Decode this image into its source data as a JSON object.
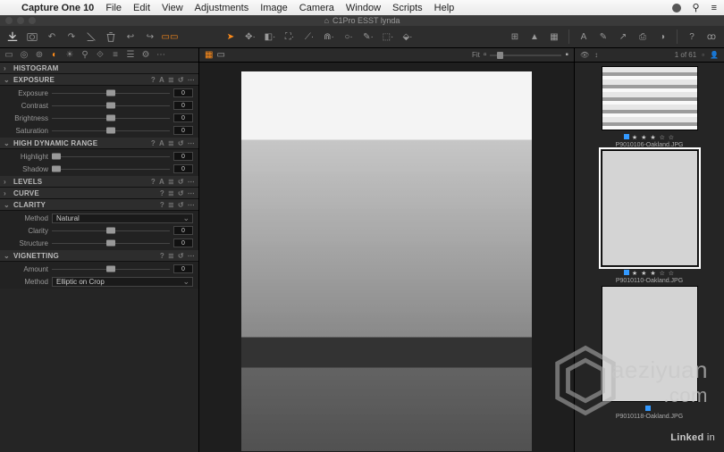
{
  "menubar": {
    "app": "Capture One 10",
    "items": [
      "File",
      "Edit",
      "View",
      "Adjustments",
      "Image",
      "Camera",
      "Window",
      "Scripts",
      "Help"
    ]
  },
  "window": {
    "title": "C1Pro ESST lynda"
  },
  "left_panel": {
    "histogram": "HISTOGRAM",
    "exposure": {
      "title": "EXPOSURE",
      "exposure": {
        "label": "Exposure",
        "value": "0"
      },
      "contrast": {
        "label": "Contrast",
        "value": "0"
      },
      "brightness": {
        "label": "Brightness",
        "value": "0"
      },
      "saturation": {
        "label": "Saturation",
        "value": "0"
      }
    },
    "hdr": {
      "title": "HIGH DYNAMIC RANGE",
      "highlight": {
        "label": "Highlight",
        "value": "0"
      },
      "shadow": {
        "label": "Shadow",
        "value": "0"
      }
    },
    "levels": {
      "title": "LEVELS"
    },
    "curve": {
      "title": "CURVE"
    },
    "clarity": {
      "title": "CLARITY",
      "method": {
        "label": "Method",
        "value": "Natural"
      },
      "clarity": {
        "label": "Clarity",
        "value": "0"
      },
      "structure": {
        "label": "Structure",
        "value": "0"
      }
    },
    "vignetting": {
      "title": "VIGNETTING",
      "amount": {
        "label": "Amount",
        "value": "0"
      },
      "method": {
        "label": "Method",
        "value": "Elliptic on Crop"
      }
    }
  },
  "viewer": {
    "fit": "Fit"
  },
  "browser": {
    "count": "1 of 61",
    "items": [
      {
        "filename": "P9010106-Oakland.JPG",
        "rating": "★ ★ ★ ☆ ☆"
      },
      {
        "filename": "P9010110-Oakland.JPG",
        "rating": "★ ★ ★ ☆ ☆"
      },
      {
        "filename": "P9010118-Oakland.JPG",
        "rating": ""
      }
    ]
  },
  "watermark": {
    "line1": "aeziyuan",
    "line2": ".com",
    "corner": "Linked in"
  }
}
